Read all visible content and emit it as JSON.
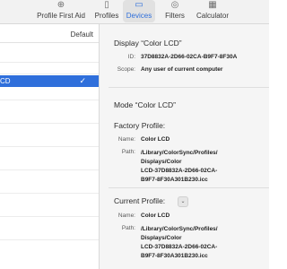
{
  "toolbar": {
    "items": [
      {
        "label": "Profile First Aid",
        "icon": "first-aid-icon",
        "glyph": "⊕"
      },
      {
        "label": "Profiles",
        "icon": "profiles-icon",
        "glyph": "▯"
      },
      {
        "label": "Devices",
        "icon": "devices-icon",
        "glyph": "▭",
        "active": true
      },
      {
        "label": "Filters",
        "icon": "filters-icon",
        "glyph": "◎"
      },
      {
        "label": "Calculator",
        "icon": "calculator-icon",
        "glyph": "▦"
      }
    ],
    "accent_color": "#2f6fdb"
  },
  "sidebar": {
    "default_label": "Default",
    "selected_device": "CD",
    "check_glyph": "✓"
  },
  "detail": {
    "display_title": "Display “Color LCD”",
    "id_key": "ID:",
    "id_value": "37D8832A-2D66-02CA-B9F7-8F30A",
    "scope_key": "Scope:",
    "scope_value": "Any user of current computer",
    "mode_title": "Mode “Color LCD”",
    "factory": {
      "title": "Factory Profile:",
      "name_key": "Name:",
      "name_value": "Color LCD",
      "path_key": "Path:",
      "path_value": "/Library/ColorSync/Profiles/\nDisplays/Color\nLCD-37D8832A-2D66-02CA-\nB9F7-8F30A301B230.icc"
    },
    "current": {
      "title": "Current Profile:",
      "popup_glyph": "⌄",
      "name_key": "Name:",
      "name_value": "Color LCD",
      "path_key": "Path:",
      "path_value": "/Library/ColorSync/Profiles/\nDisplays/Color\nLCD-37D8832A-2D66-02CA-\nB9F7-8F30A301B230.icc"
    }
  }
}
